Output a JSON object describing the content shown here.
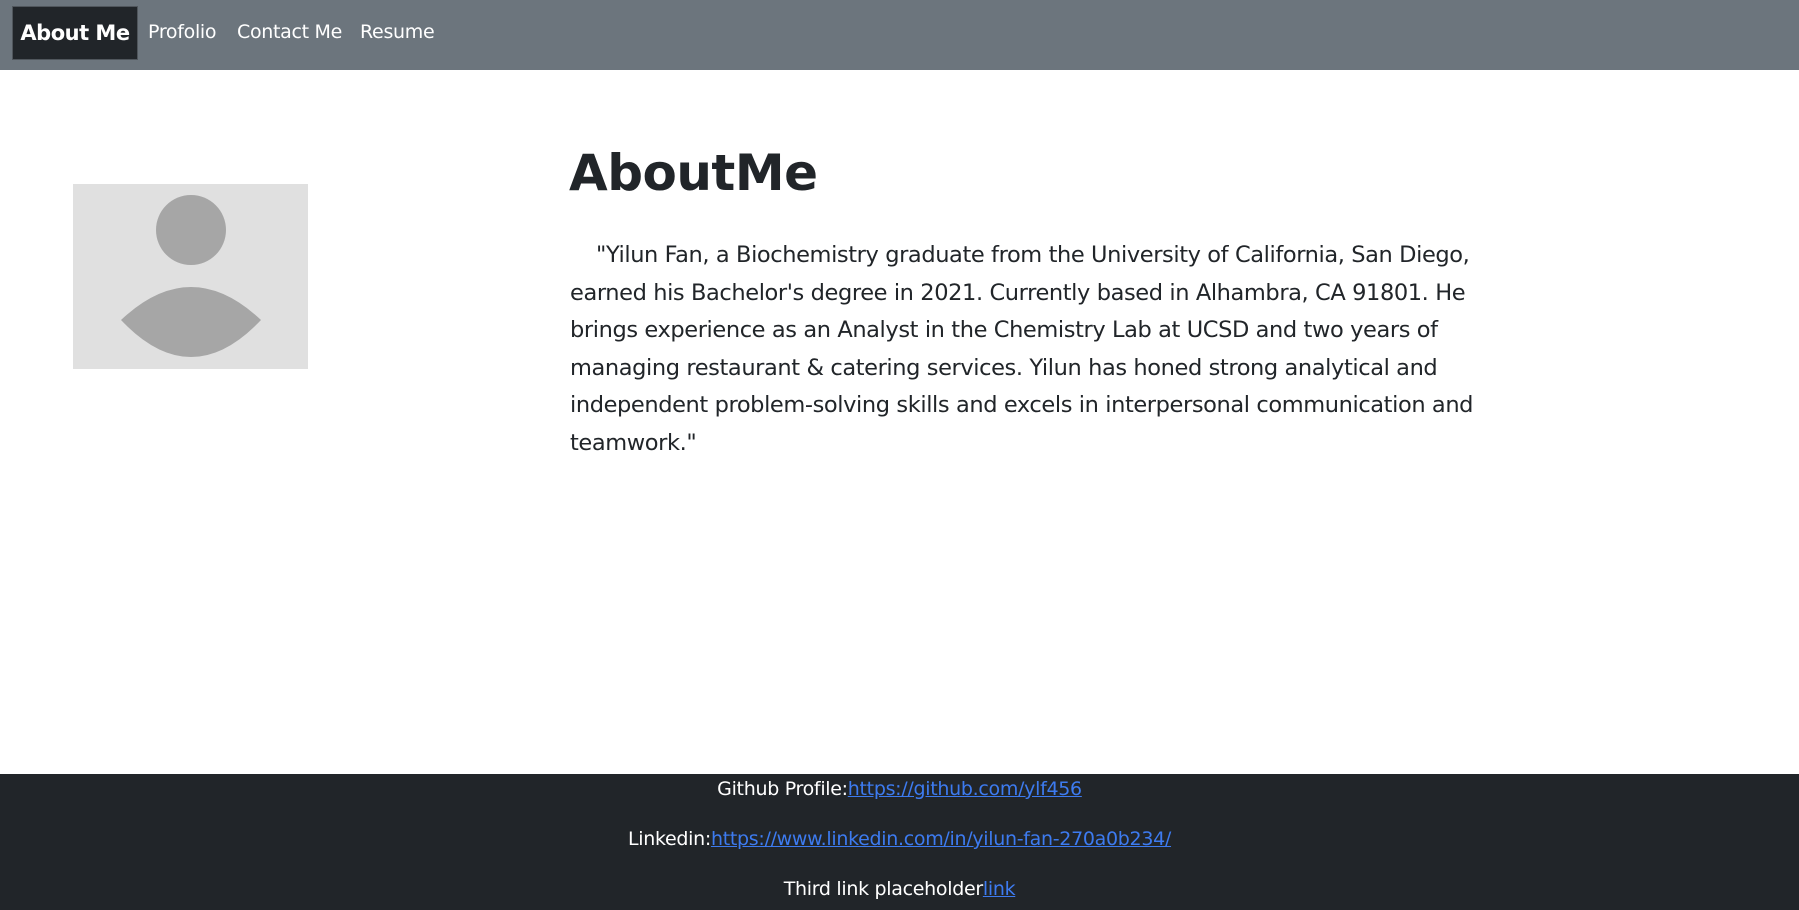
{
  "navbar": {
    "brand": "About Me",
    "links": [
      "Profolio",
      "Contact Me",
      "Resume"
    ]
  },
  "avatar": {
    "icon": "user-avatar-placeholder-icon"
  },
  "main": {
    "heading": "AboutMe",
    "bio": "\"Yilun Fan, a Biochemistry graduate from the University of California, San Diego, earned his Bachelor's degree in 2021. Currently based in Alhambra, CA 91801. He brings experience as an Analyst in the Chemistry Lab at UCSD and two years of managing restaurant & catering services. Yilun has honed strong analytical and independent problem-solving skills and excels in interpersonal communication and teamwork.\""
  },
  "footer": {
    "github_label": "Github Profile:",
    "github_link": "https://github.com/ylf456",
    "linkedin_label": "Linkedin:",
    "linkedin_link": "https://www.linkedin.com/in/yilun-fan-270a0b234/",
    "third_label": "Third link placeholder",
    "third_link": "link"
  },
  "colors": {
    "navbar_bg": "#6c757d",
    "brand_bg": "#212529",
    "footer_bg": "#212529",
    "link": "#3d7bf0",
    "avatar_bg": "#e0e0e0",
    "avatar_figure": "#a6a6a6"
  }
}
